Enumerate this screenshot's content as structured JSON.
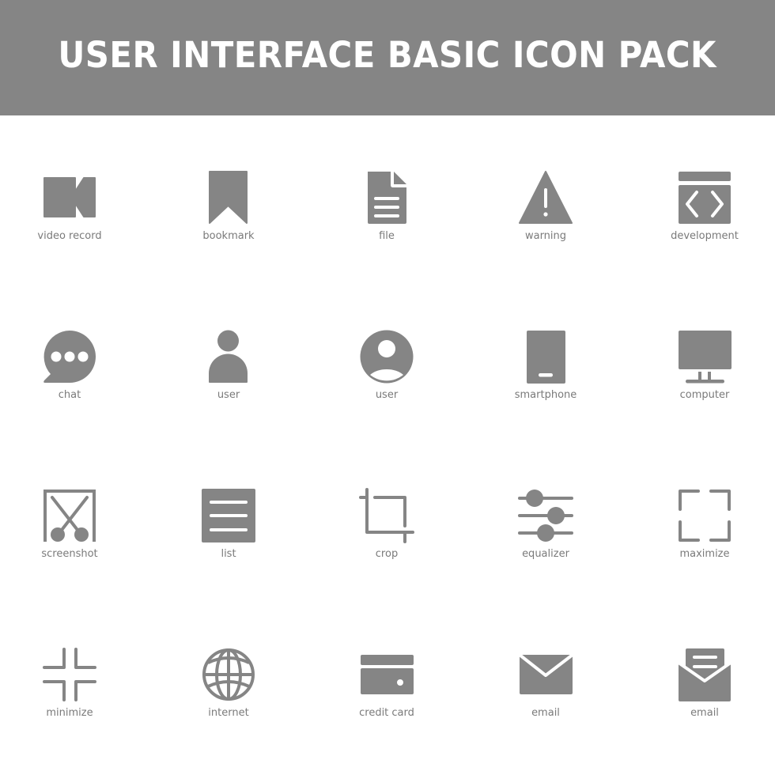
{
  "header": {
    "title": "USER INTERFACE BASIC ICON PACK",
    "background_color": "#858585",
    "text_color": "#ffffff"
  },
  "icon_color": "#858585",
  "label_color": "#7a7a7a",
  "icons": [
    {
      "name": "video-record-icon",
      "label": "video record"
    },
    {
      "name": "bookmark-icon",
      "label": "bookmark"
    },
    {
      "name": "file-icon",
      "label": "file"
    },
    {
      "name": "warning-icon",
      "label": "warning"
    },
    {
      "name": "development-icon",
      "label": "development"
    },
    {
      "name": "chat-icon",
      "label": "chat"
    },
    {
      "name": "user-icon",
      "label": "user"
    },
    {
      "name": "user-circle-icon",
      "label": "user"
    },
    {
      "name": "smartphone-icon",
      "label": "smartphone"
    },
    {
      "name": "computer-icon",
      "label": "computer"
    },
    {
      "name": "screenshot-icon",
      "label": "screenshot"
    },
    {
      "name": "list-icon",
      "label": "list"
    },
    {
      "name": "crop-icon",
      "label": "crop"
    },
    {
      "name": "equalizer-icon",
      "label": "equalizer"
    },
    {
      "name": "maximize-icon",
      "label": "maximize"
    },
    {
      "name": "minimize-icon",
      "label": "minimize"
    },
    {
      "name": "internet-icon",
      "label": "internet"
    },
    {
      "name": "credit-card-icon",
      "label": "credit card"
    },
    {
      "name": "email-icon",
      "label": "email"
    },
    {
      "name": "email-open-icon",
      "label": "email"
    }
  ]
}
